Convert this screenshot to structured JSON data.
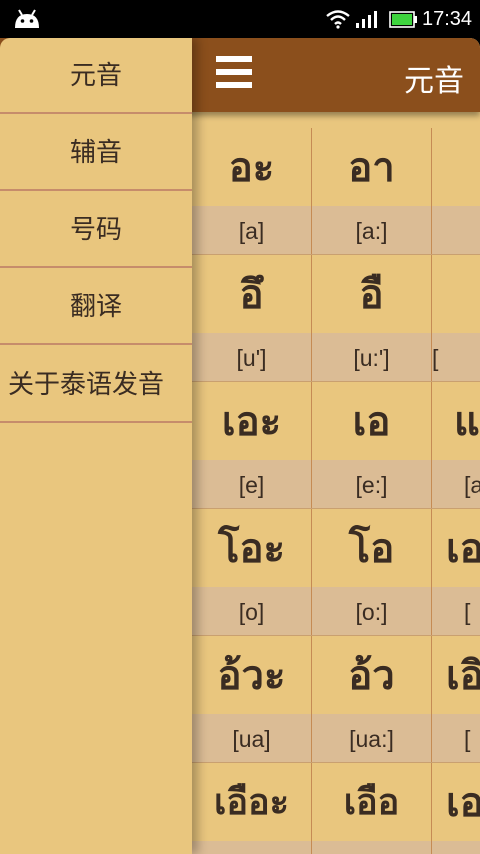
{
  "status_bar": {
    "time": "17:34",
    "icons": [
      "android-icon",
      "wifi-icon",
      "signal-icon",
      "battery-icon"
    ],
    "battery_color": "#3ed43e"
  },
  "app_bar": {
    "title": "元音",
    "background": "#8b4f1c",
    "menu_icon": "hamburger-icon"
  },
  "drawer": {
    "items": [
      {
        "label": "元音"
      },
      {
        "label": "辅音"
      },
      {
        "label": "号码"
      },
      {
        "label": "翻译"
      },
      {
        "label": "关于泰语发音"
      }
    ]
  },
  "vowels": {
    "rows": [
      {
        "cells": [
          {
            "symbol": "อะ",
            "phonetic": "[a]"
          },
          {
            "symbol": "อา",
            "phonetic": "[a:]"
          },
          {
            "symbol": "",
            "phonetic": ""
          }
        ]
      },
      {
        "cells": [
          {
            "symbol": "อึ",
            "phonetic": "[u']"
          },
          {
            "symbol": "อื",
            "phonetic": "[u:']"
          },
          {
            "symbol": "",
            "phonetic": "["
          }
        ]
      },
      {
        "cells": [
          {
            "symbol": "เอะ",
            "phonetic": "[e]"
          },
          {
            "symbol": "เอ",
            "phonetic": "[e:]"
          },
          {
            "symbol": "แ",
            "phonetic": "[a"
          }
        ]
      },
      {
        "cells": [
          {
            "symbol": "โอะ",
            "phonetic": "[o]"
          },
          {
            "symbol": "โอ",
            "phonetic": "[o:]"
          },
          {
            "symbol": "เอ",
            "phonetic": "["
          }
        ]
      },
      {
        "cells": [
          {
            "symbol": "อ้วะ",
            "phonetic": "[ua]"
          },
          {
            "symbol": "อ้ว",
            "phonetic": "[ua:]"
          },
          {
            "symbol": "เอิ",
            "phonetic": "["
          }
        ]
      },
      {
        "cells": [
          {
            "symbol": "เอือะ",
            "phonetic": ""
          },
          {
            "symbol": "เอือ",
            "phonetic": ""
          },
          {
            "symbol": "เอ",
            "phonetic": ""
          }
        ]
      }
    ]
  },
  "colors": {
    "background": "#e9c67e",
    "phonetic_band": "#dbbc95",
    "divider": "#c68c6b",
    "text": "#3a2c22"
  }
}
